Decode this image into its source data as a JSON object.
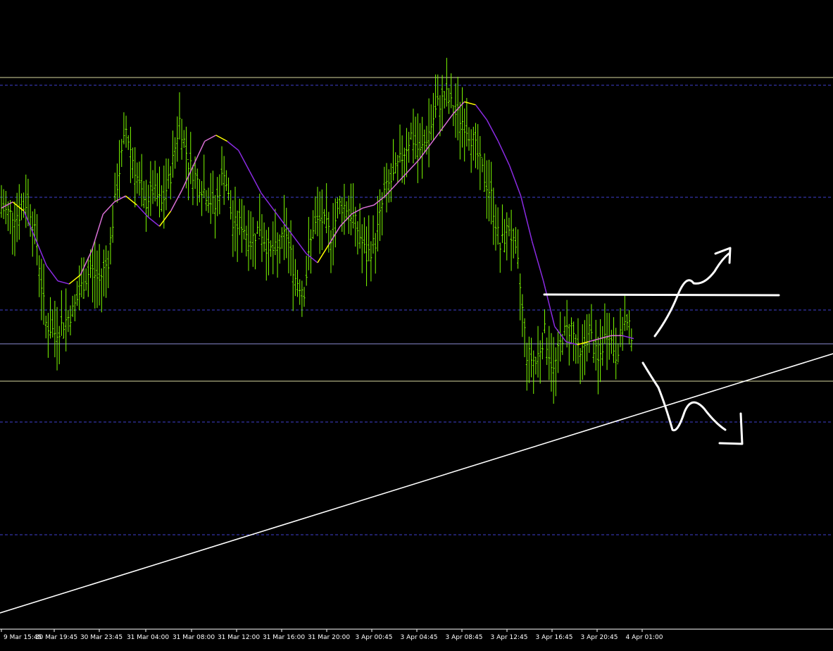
{
  "chart_data": {
    "type": "line",
    "title": "",
    "xlabel": "",
    "ylabel": "",
    "background": "#000000",
    "grid": false,
    "x_ticks": [
      "9 Mar 15:45",
      "30 Mar 19:45",
      "30 Mar 23:45",
      "31 Mar 04:00",
      "31 Mar 08:00",
      "31 Mar 12:00",
      "31 Mar 16:00",
      "31 Mar 20:00",
      "3 Apr 00:45",
      "3 Apr 04:45",
      "3 Apr 08:45",
      "3 Apr 12:45",
      "3 Apr 16:45",
      "3 Apr 20:45",
      "4 Apr 01:00"
    ],
    "series": [
      {
        "kind": "price-bars",
        "color": "#7CFC00",
        "close": [
          0.57,
          0.55,
          0.55,
          0.6,
          0.45,
          0.19,
          0.16,
          0.19,
          0.23,
          0.31,
          0.37,
          0.33,
          0.4,
          0.65,
          0.83,
          0.7,
          0.58,
          0.63,
          0.58,
          0.68,
          0.86,
          0.72,
          0.66,
          0.62,
          0.57,
          0.7,
          0.51,
          0.52,
          0.46,
          0.51,
          0.43,
          0.43,
          0.49,
          0.34,
          0.3,
          0.51,
          0.53,
          0.48,
          0.58,
          0.57,
          0.5,
          0.41,
          0.46,
          0.62,
          0.67,
          0.74,
          0.81,
          0.75,
          0.82,
          0.91,
          0.94,
          0.88,
          0.85,
          0.79,
          0.69,
          0.61,
          0.44,
          0.51,
          0.38,
          0.09,
          0.06,
          0.16,
          0.03,
          0.15,
          0.18,
          0.07,
          0.17,
          0.06,
          0.17,
          0.09,
          0.19,
          0.15
        ]
      },
      {
        "kind": "moving-average",
        "color": "#DA70D6",
        "down_color": "#8A2BE2",
        "turn_color": "#FFFF00",
        "values": [
          0.57,
          0.59,
          0.56,
          0.47,
          0.38,
          0.33,
          0.32,
          0.35,
          0.43,
          0.55,
          0.59,
          0.61,
          0.58,
          0.54,
          0.51,
          0.56,
          0.63,
          0.71,
          0.79,
          0.81,
          0.79,
          0.76,
          0.69,
          0.62,
          0.57,
          0.52,
          0.47,
          0.42,
          0.39,
          0.45,
          0.51,
          0.55,
          0.57,
          0.58,
          0.61,
          0.65,
          0.69,
          0.73,
          0.78,
          0.83,
          0.88,
          0.92,
          0.91,
          0.86,
          0.79,
          0.71,
          0.61,
          0.46,
          0.33,
          0.18,
          0.13,
          0.12,
          0.13,
          0.14,
          0.15,
          0.15,
          0.14
        ]
      }
    ],
    "horizontal_levels": [
      1.0,
      0.92,
      0.78,
      0.27,
      0.15,
      0.25,
      0.62,
      0.0
    ],
    "annotations": [
      {
        "kind": "hand-drawn-level",
        "color": "#ffffff"
      },
      {
        "kind": "hand-drawn-arrow-up",
        "color": "#ffffff"
      },
      {
        "kind": "hand-drawn-arrow-down",
        "color": "#ffffff"
      },
      {
        "kind": "trendline",
        "color": "#ffffff"
      }
    ],
    "colors": {
      "background": "#000000",
      "bars": "#7CFC00",
      "dashed_levels": "#4040D0",
      "solid_levels": "#8C8CD2",
      "axis_text": "#ffffff",
      "annotation": "#ffffff"
    }
  }
}
